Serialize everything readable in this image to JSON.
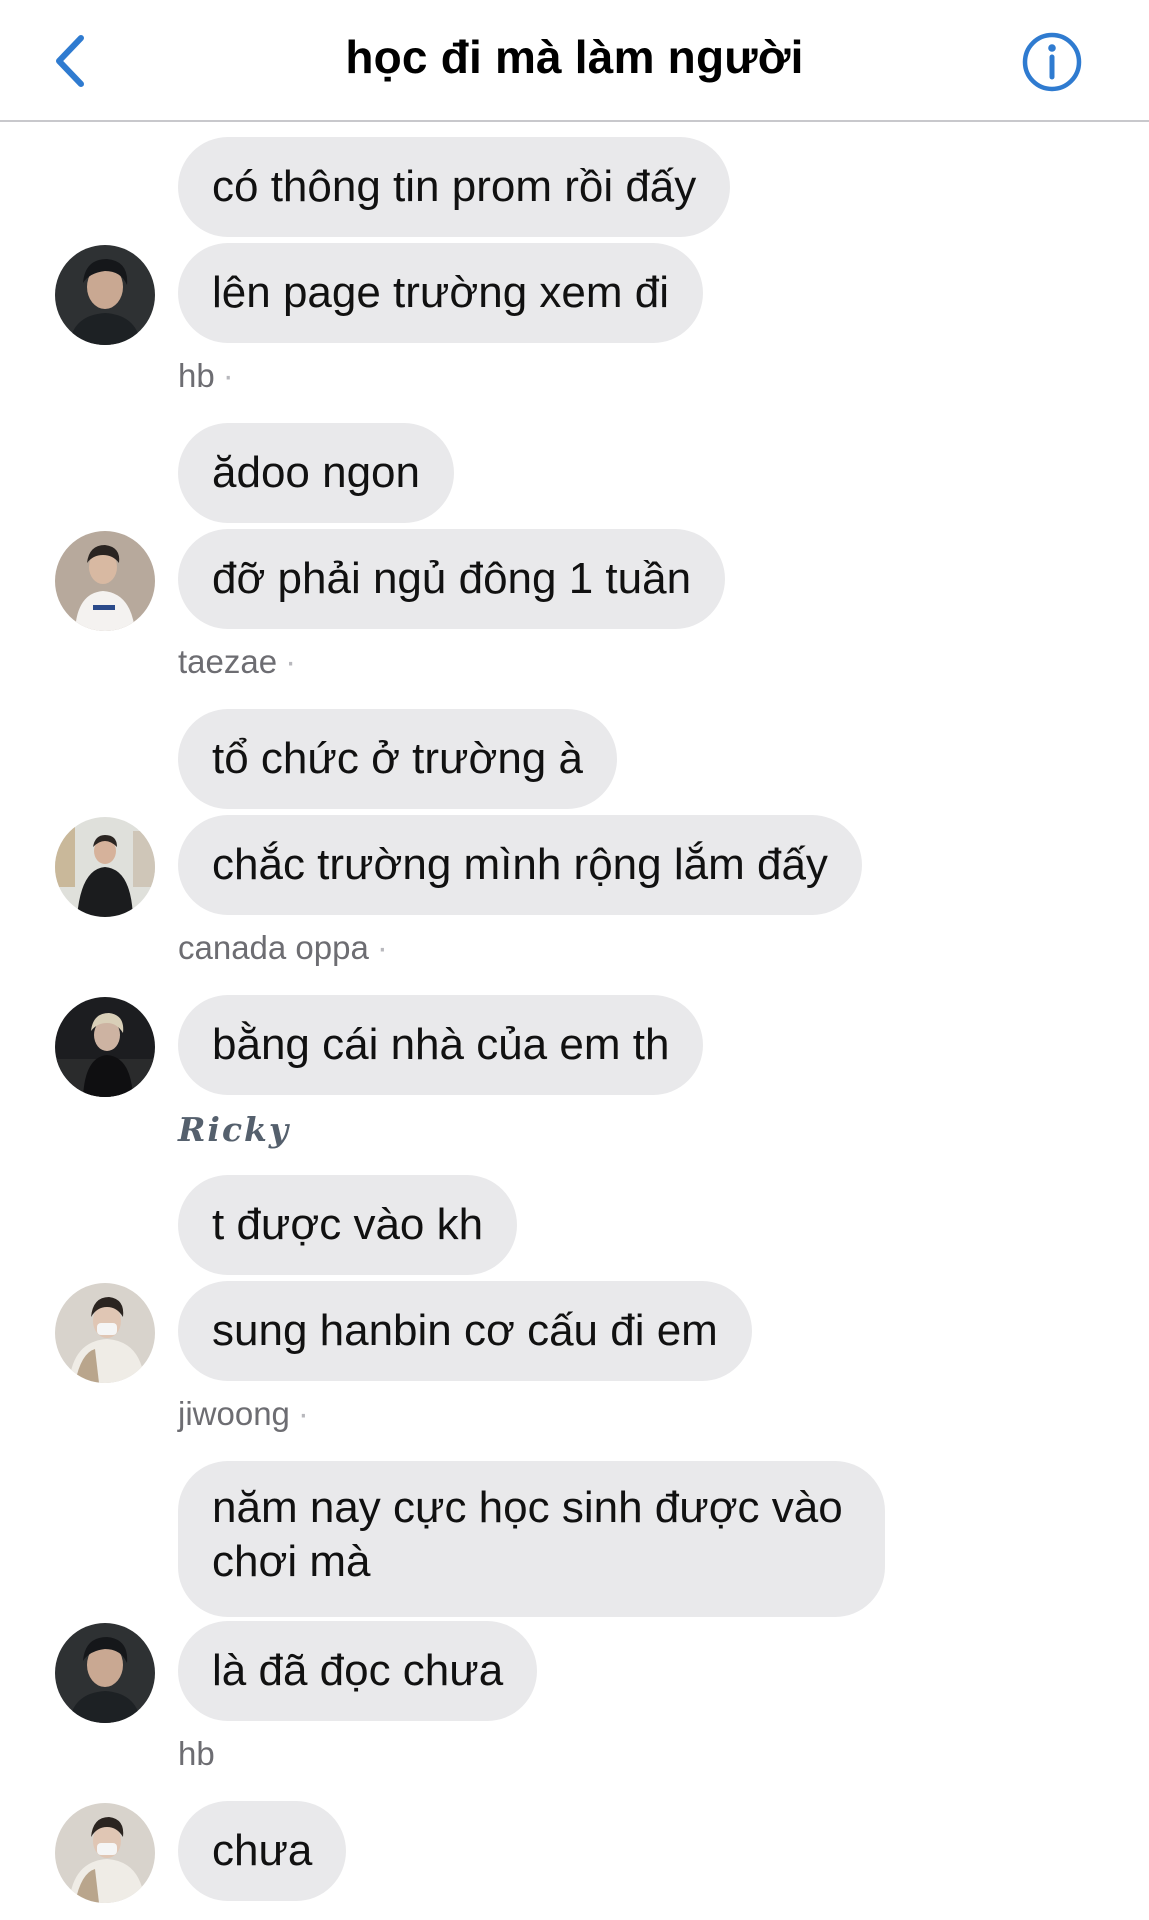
{
  "header": {
    "title": "học đi mà làm người",
    "back_icon": "chevron-left-icon",
    "info_icon": "info-icon",
    "accent_color": "#2f7bd0"
  },
  "messages": [
    {
      "text": "có thông tin prom rồi đấy"
    },
    {
      "text": "lên page trường xem đi"
    },
    {
      "sender": "hb"
    },
    {
      "text": "ădoo ngon"
    },
    {
      "text": "đỡ phải ngủ đông 1 tuần"
    },
    {
      "sender": "taezae"
    },
    {
      "text": "tổ chức ở trường à"
    },
    {
      "text": "chắc trường mình rộng lắm đấy"
    },
    {
      "sender": "canada oppa"
    },
    {
      "text": "bằng cái nhà của em th"
    },
    {
      "sender": "Ricky"
    },
    {
      "text": "t được vào kh"
    },
    {
      "text": "sung hanbin cơ cấu đi em"
    },
    {
      "sender": "jiwoong"
    },
    {
      "text": "năm nay cực học sinh được vào chơi mà"
    },
    {
      "text": "là đã đọc chưa"
    },
    {
      "sender": "hb"
    },
    {
      "text": "chưa"
    }
  ],
  "separator": "·",
  "colors": {
    "bubble": "#e9e9eb",
    "sender_text": "#6d6d72",
    "divider": "#c8c8cc"
  }
}
